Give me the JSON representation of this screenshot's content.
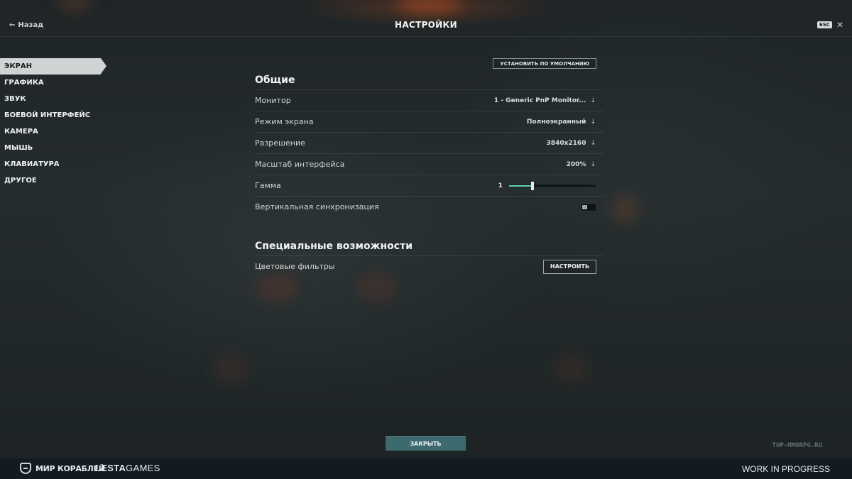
{
  "header": {
    "back_label": "Назад",
    "title": "НАСТРОЙКИ",
    "esc_key": "ESC"
  },
  "sidebar": {
    "active_index": 0,
    "items": [
      {
        "label": "ЭКРАН"
      },
      {
        "label": "ГРАФИКА"
      },
      {
        "label": "ЗВУК"
      },
      {
        "label": "БОЕВОЙ ИНТЕРФЕЙС"
      },
      {
        "label": "КАМЕРА"
      },
      {
        "label": "МЫШЬ"
      },
      {
        "label": "КЛАВИАТУРА"
      },
      {
        "label": "ДРУГОЕ"
      }
    ]
  },
  "general": {
    "default_button": "УСТАНОВИТЬ ПО УМОЛЧАНИЮ",
    "title": "Общие",
    "monitor": {
      "label": "Монитор",
      "value": "1 - Generic PnP Monitor..."
    },
    "screen_mode": {
      "label": "Режим экрана",
      "value": "Полноэкранный"
    },
    "resolution": {
      "label": "Разрешение",
      "value": "3840x2160"
    },
    "ui_scale": {
      "label": "Масштаб интерфейса",
      "value": "200%"
    },
    "gamma": {
      "label": "Гамма",
      "value": "1",
      "level": 0.27
    },
    "vsync": {
      "label": "Вертикальная синхронизация",
      "enabled": false
    }
  },
  "accessibility": {
    "title": "Специальные возможности",
    "color_filters": {
      "label": "Цветовые фильтры",
      "button": "НАСТРОИТЬ"
    }
  },
  "close_button": "ЗАКРЫТЬ",
  "footer": {
    "brand": "МИР КОРАБЛЕЙ",
    "publisher_bold": "LESTA",
    "publisher_rest": "GAMES",
    "status": "WORK IN PROGRESS"
  },
  "watermark": "TOP-MMORPG.RU",
  "colors": {
    "accent": "#62d6b4",
    "close_button": "#3d6a6f",
    "active_tab": "#cfd3d3"
  }
}
